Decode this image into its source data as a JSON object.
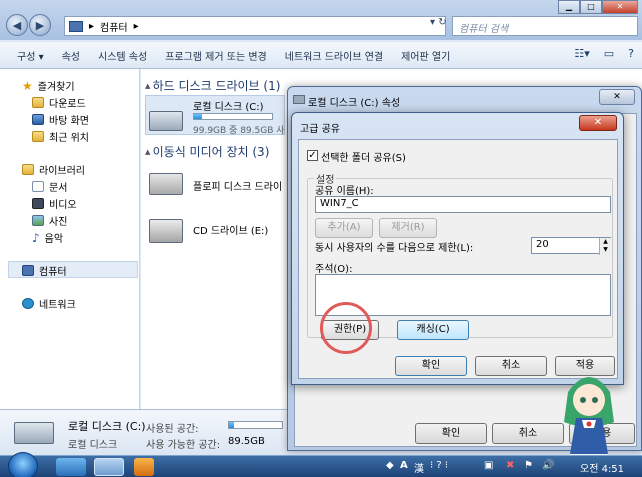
{
  "explorer": {
    "breadcrumb": "컴퓨터",
    "search_placeholder": "컴퓨터 검색",
    "toolbar": [
      "구성 ▾",
      "속성",
      "시스템 속성",
      "프로그램 제거 또는 변경",
      "네트워크 드라이브 연결",
      "제어판 열기"
    ],
    "sidebar": {
      "favorites": "즐겨찾기",
      "favorites_items": [
        "다운로드",
        "바탕 화면",
        "최근 위치"
      ],
      "libraries": "라이브러리",
      "libraries_items": [
        "문서",
        "비디오",
        "사진",
        "음악"
      ],
      "computer": "컴퓨터",
      "network": "네트워크"
    },
    "groups": {
      "hdd": "하드 디스크 드라이브 (1)",
      "removable": "이동식 미디어 장치 (3)"
    },
    "drives": {
      "local_name": "로컬 디스크 (C:)",
      "local_space": "99.9GB 중 89.5GB 사",
      "local_fill": 0.1,
      "floppy": "플로피 디스크 드라이",
      "cd": "CD 드라이브 (E:)"
    },
    "details": {
      "name": "로컬 디스크 (C:)",
      "type": "로컬 디스크",
      "used_label": "사용된 공간:",
      "free_label": "사용 가능한 공간:",
      "free_value": "89.5GB",
      "used_fill": 0.1
    }
  },
  "properties": {
    "title": "로컬 디스크 (C:) 속성",
    "ok": "확인",
    "cancel": "취소",
    "apply": "적용"
  },
  "advanced": {
    "title": "고급 공유",
    "share_checkbox": "선택한 폴더 공유(S)",
    "share_checked": true,
    "settings": "설정",
    "share_name_label": "공유 이름(H):",
    "share_name_value": "WIN7_C",
    "add": "추가(A)",
    "remove": "제거(R)",
    "limit_label": "동시 사용자의 수를 다음으로 제한(L):",
    "limit_value": "20",
    "comment_label": "주석(O):",
    "comment_value": "",
    "permissions": "권한(P)",
    "caching": "캐싱(C)",
    "ok": "확인",
    "cancel": "취소",
    "apply": "적용"
  },
  "taskbar": {
    "ime_a": "A",
    "ime_han": "漢",
    "clock": "오전 4:51"
  },
  "colors": {
    "highlight_circle": "#e05a5a",
    "accent": "#1f8fe6"
  }
}
